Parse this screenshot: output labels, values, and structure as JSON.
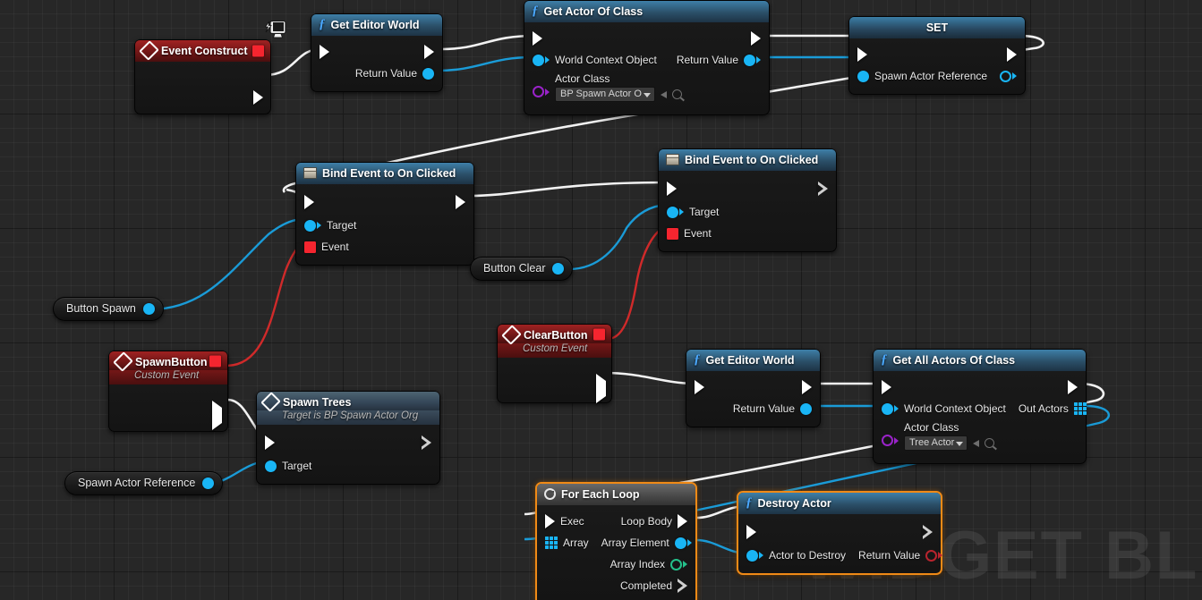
{
  "graph": {
    "watermark": "WIDGET BLUE",
    "background_color": "#272727"
  },
  "nodes": {
    "event_construct": {
      "title": "Event Construct",
      "icon": "event-diamond-icon",
      "badge_icon": "widget-screen-icon",
      "delegate_pin": "red-square-pin"
    },
    "get_editor_world_1": {
      "title": "Get Editor World",
      "icon": "function-f-icon",
      "out_value": "Return Value"
    },
    "get_actor_of_class": {
      "title": "Get Actor Of Class",
      "icon": "function-f-icon",
      "in_world": "World Context Object",
      "in_class_label": "Actor Class",
      "in_class_value": "BP Spawn Actor O",
      "out_value": "Return Value"
    },
    "set_node": {
      "title": "SET",
      "in_value": "Spawn Actor Reference"
    },
    "bind_event_spawn": {
      "title": "Bind Event to On Clicked",
      "icon": "widget-icon",
      "in_target": "Target",
      "in_event": "Event"
    },
    "bind_event_clear": {
      "title": "Bind Event to On Clicked",
      "icon": "widget-icon",
      "in_target": "Target",
      "in_event": "Event"
    },
    "spawn_button": {
      "title": "SpawnButton",
      "subtitle": "Custom Event",
      "icon": "event-diamond-icon",
      "delegate_pin": "red-square-pin"
    },
    "clear_button": {
      "title": "ClearButton",
      "subtitle": "Custom Event",
      "icon": "event-diamond-icon",
      "delegate_pin": "red-square-pin"
    },
    "spawn_trees": {
      "title": "Spawn Trees",
      "subtitle": "Target is BP Spawn Actor Org",
      "icon": "event-diamond-icon",
      "in_target": "Target"
    },
    "get_editor_world_2": {
      "title": "Get Editor World",
      "icon": "function-f-icon",
      "out_value": "Return Value"
    },
    "get_all_actors_of_class": {
      "title": "Get All Actors Of Class",
      "icon": "function-f-icon",
      "in_world": "World Context Object",
      "in_class_label": "Actor Class",
      "in_class_value": "Tree Actor",
      "out_value": "Out Actors"
    },
    "for_each_loop": {
      "title": "For Each Loop",
      "icon": "loop-icon",
      "in_exec": "Exec",
      "in_array": "Array",
      "out_loop_body": "Loop Body",
      "out_array_element": "Array Element",
      "out_array_index": "Array Index",
      "out_completed": "Completed",
      "selected": true
    },
    "destroy_actor": {
      "title": "Destroy Actor",
      "icon": "function-f-icon",
      "in_actor": "Actor to Destroy",
      "out_value": "Return Value",
      "selected": true
    }
  },
  "variables": {
    "button_spawn": "Button Spawn",
    "button_clear": "Button Clear",
    "spawn_actor_reference": "Spawn Actor Reference"
  },
  "colors": {
    "exec_wire": "#f2f2f2",
    "object_wire": "#1a9bd7",
    "delegate_wire": "#d02a2a",
    "selection": "#f08a16",
    "object_pin": "#19b5f5",
    "delegate_pin": "#f5252f",
    "int_pin": "#24c08a",
    "bool_pin": "#b8242e",
    "class_pin": "#9a23c9"
  }
}
